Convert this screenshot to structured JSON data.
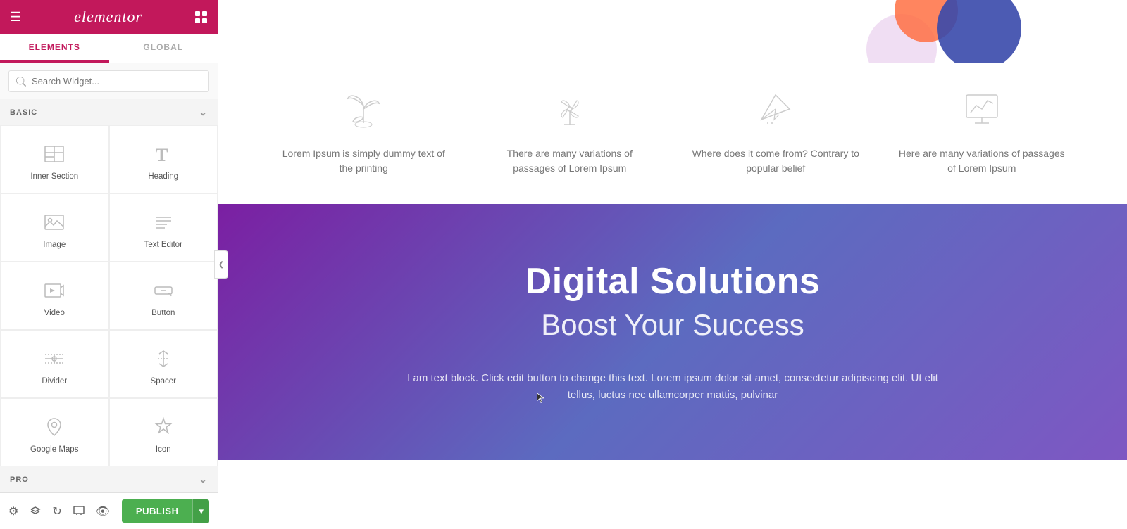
{
  "sidebar": {
    "logo": "elementor",
    "tabs": [
      {
        "id": "elements",
        "label": "ELEMENTS",
        "active": true
      },
      {
        "id": "global",
        "label": "GLOBAL",
        "active": false
      }
    ],
    "search": {
      "placeholder": "Search Widget..."
    },
    "basic_section": {
      "label": "BASIC",
      "collapsed": false
    },
    "widgets": [
      {
        "id": "inner-section",
        "label": "Inner Section",
        "icon": "inner-section"
      },
      {
        "id": "heading",
        "label": "Heading",
        "icon": "heading"
      },
      {
        "id": "image",
        "label": "Image",
        "icon": "image"
      },
      {
        "id": "text-editor",
        "label": "Text Editor",
        "icon": "text-editor"
      },
      {
        "id": "video",
        "label": "Video",
        "icon": "video"
      },
      {
        "id": "button",
        "label": "Button",
        "icon": "button"
      },
      {
        "id": "divider",
        "label": "Divider",
        "icon": "divider"
      },
      {
        "id": "spacer",
        "label": "Spacer",
        "icon": "spacer"
      },
      {
        "id": "google-maps",
        "label": "Google Maps",
        "icon": "google-maps"
      },
      {
        "id": "icon",
        "label": "Icon",
        "icon": "icon-widget"
      }
    ],
    "pro_section": {
      "label": "PRO",
      "collapsed": false
    },
    "bottom": {
      "publish_label": "PUBLISH",
      "publish_arrow": "▾"
    }
  },
  "canvas": {
    "features": [
      {
        "icon": "plant",
        "text": "Lorem Ipsum is simply dummy text of the printing"
      },
      {
        "icon": "pinwheel",
        "text": "There are many variations of passages of Lorem Ipsum"
      },
      {
        "icon": "paper-plane",
        "text": "Where does it come from? Contrary to popular belief"
      },
      {
        "icon": "monitor-chart",
        "text": "Here are many variations of passages of Lorem Ipsum"
      }
    ],
    "hero": {
      "title": "Digital Solutions",
      "subtitle": "Boost Your Success",
      "body": "I am text block. Click edit button to change this text. Lorem ipsum dolor sit amet, consectetur adipiscing elit. Ut elit tellus, luctus nec ullamcorper mattis, pulvinar"
    }
  }
}
